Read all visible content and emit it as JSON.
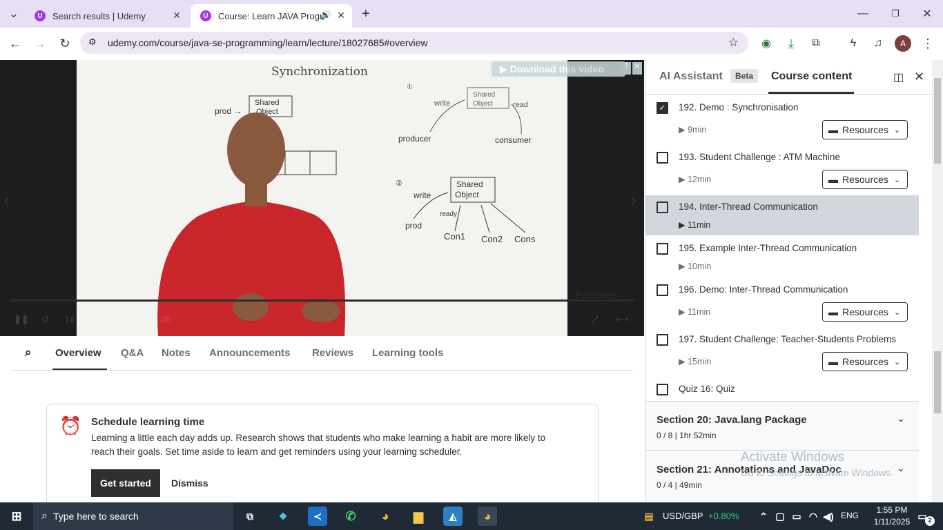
{
  "browser": {
    "tabs": [
      {
        "label": "Search results | Udemy",
        "favicon": "U"
      },
      {
        "label": "Course: Learn JAVA Program",
        "favicon": "U"
      }
    ],
    "url": "udemy.com/course/java-se-programming/learn/lecture/18027685#overview"
  },
  "video": {
    "download_label": "Download this video",
    "fullscreen_label": "Fullscreen",
    "speed": "1x",
    "time": "0:38 / 11:05",
    "board": {
      "title": "Synchronization",
      "prod1": "prod →",
      "shared": "Shared Object",
      "write": "write",
      "read": "read",
      "producer": "producer",
      "consumer": "consumer",
      "prod2": "prod",
      "ready": "ready",
      "con1": "Con1",
      "con2": "Con2",
      "con3": "Cons"
    }
  },
  "lecture_tabs": [
    "Overview",
    "Q&A",
    "Notes",
    "Announcements",
    "Reviews",
    "Learning tools"
  ],
  "schedule": {
    "title": "Schedule learning time",
    "line1": "Learning a little each day adds up. Research shows that students who make learning a habit are more likely to",
    "line2": "reach their goals. Set time aside to learn and get reminders using your learning scheduler.",
    "get_started": "Get started",
    "dismiss": "Dismiss"
  },
  "sidebar": {
    "ai_tab": "AI Assistant",
    "beta": "Beta",
    "content_tab": "Course content",
    "items": [
      {
        "title": "192. Demo : Synchronisation",
        "duration": "9min",
        "checked": true,
        "resources": true
      },
      {
        "title": "193. Student Challenge : ATM Machine",
        "duration": "12min",
        "checked": false,
        "resources": true
      },
      {
        "title": "194. Inter-Thread Communication",
        "duration": "11min",
        "checked": false,
        "resources": false
      },
      {
        "title": "195. Example Inter-Thread Communication",
        "duration": "10min",
        "checked": false,
        "resources": false
      },
      {
        "title": "196. Demo: Inter-Thread Communication",
        "duration": "11min",
        "checked": false,
        "resources": true
      },
      {
        "title": "197. Student Challenge: Teacher-Students Problems",
        "duration": "15min",
        "checked": false,
        "resources": true
      },
      {
        "title": "Quiz 16: Quiz",
        "duration": "",
        "checked": false,
        "resources": false
      }
    ],
    "resources_label": "Resources",
    "sections": [
      {
        "title": "Section 20: Java.lang Package",
        "meta": "0 / 8 | 1hr 52min"
      },
      {
        "title": "Section 21: Annotations and JavaDoc",
        "meta": "0 / 4 | 49min"
      }
    ],
    "watermark1": "Activate Windows",
    "watermark2": "Go to Settings to activate Windows."
  },
  "taskbar": {
    "search_placeholder": "Type here to search",
    "ticker": "USD/GBP",
    "ticker_change": "+0.80%",
    "lang": "ENG",
    "time": "1:55 PM",
    "date": "1/11/2025",
    "notif_count": "2"
  }
}
